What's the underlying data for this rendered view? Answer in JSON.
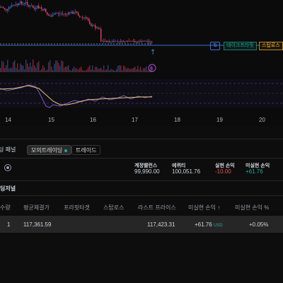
{
  "chart": {
    "dates": [
      "14",
      "15",
      "16",
      "17",
      "18",
      "19",
      "20"
    ],
    "take_profit_label": "테이크프라핏",
    "stop_loss_label": "스탑로스",
    "tp_badge_icon": "swap-icon"
  },
  "tabs": {
    "panel_label": "딩 패널",
    "paper_trading_label": "모의트레이딩",
    "trades_label": "트레이드"
  },
  "account": {
    "balance_label": "계정밸런스",
    "balance_value": "99,990.00",
    "equity_label": "에퀴티",
    "equity_value": "100,051.76",
    "realized_label": "실현 손익",
    "realized_value": "-10.00",
    "unrealized_label": "미실현 손익",
    "unrealized_value": "+61.76"
  },
  "positions": {
    "section_title": "딩저널",
    "headers": {
      "qty": "수량",
      "avg_price": "평균체결가",
      "tp": "프라핏타겟",
      "sl": "스탑로스",
      "last": "라스트 프라이스",
      "upnl": "미실현 손익 ↑",
      "upnl_pct": "미실현 손익 %"
    },
    "row": {
      "qty": "1",
      "avg_price": "117,361.59",
      "last": "117,423.31",
      "upnl": "+61.76",
      "upnl_unit": "USD",
      "upnl_pct": "+0.05%"
    }
  }
}
